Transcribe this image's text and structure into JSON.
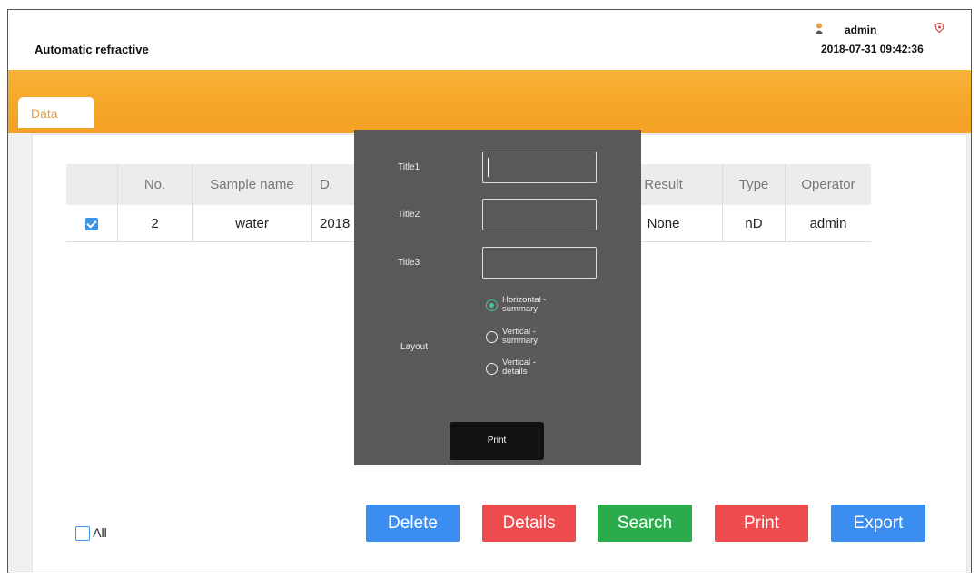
{
  "app": {
    "title": "Automatic refractive",
    "user": "admin",
    "datetime": "2018-07-31 09:42:36"
  },
  "tabs": [
    {
      "label": "Data",
      "active": true
    }
  ],
  "table": {
    "headers": [
      "",
      "No.",
      "Sample name",
      "D",
      "Result",
      "Type",
      "Operator"
    ],
    "rows": [
      {
        "checked": true,
        "no": "2",
        "sample": "water",
        "date": "2018",
        "result": "None",
        "type": "nD",
        "operator": "admin"
      }
    ]
  },
  "select_all": {
    "label": "All",
    "checked": false
  },
  "buttons": {
    "delete": "Delete",
    "details": "Details",
    "search": "Search",
    "print": "Print",
    "export": "Export"
  },
  "print_dialog": {
    "title1_label": "Title1",
    "title1_value": "",
    "title2_label": "Title2",
    "title2_value": "",
    "title3_label": "Title3",
    "title3_value": "",
    "layout_label": "Layout",
    "layout_options": [
      {
        "line1": "Horizontal -",
        "line2": "summary",
        "selected": true
      },
      {
        "line1": "Vertical -",
        "line2": "summary",
        "selected": false
      },
      {
        "line1": "Vertical -",
        "line2": "details",
        "selected": false
      }
    ],
    "print_button": "Print"
  },
  "colors": {
    "banner": "#f6a92c",
    "tab_text": "#e3a043",
    "blue": "#3b8ef0",
    "red": "#ee4b4e",
    "green": "#2cab4c",
    "dialog_bg": "#595959",
    "radio_selected": "#3fc4a3"
  },
  "icons": {
    "user": "user-icon",
    "shield": "shield-icon"
  }
}
